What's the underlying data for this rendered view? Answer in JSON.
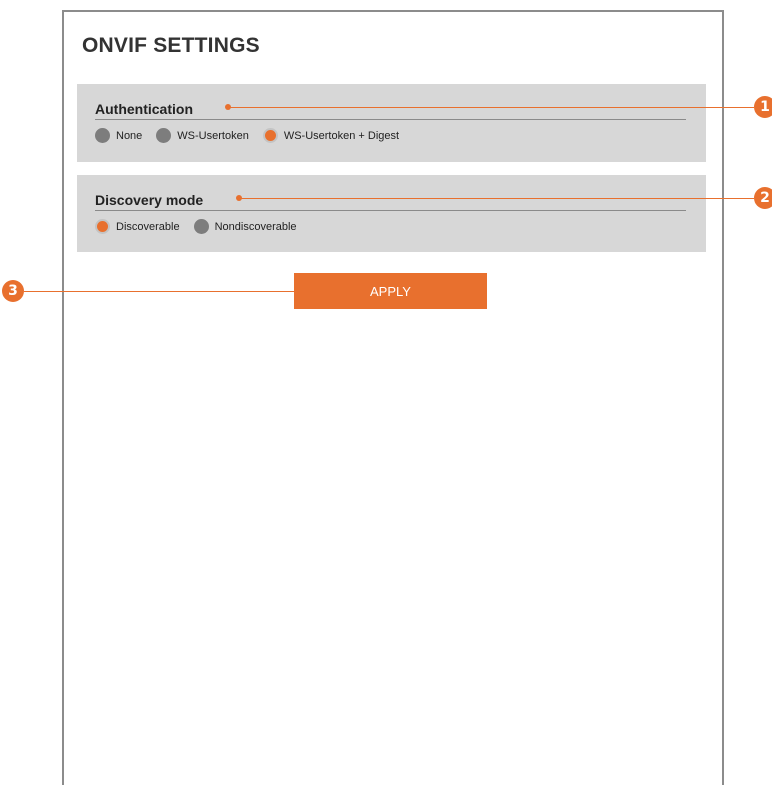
{
  "page": {
    "title": "ONVIF SETTINGS"
  },
  "authentication": {
    "label": "Authentication",
    "options": [
      "None",
      "WS-Usertoken",
      "WS-Usertoken + Digest"
    ],
    "selected": "WS-Usertoken + Digest"
  },
  "discovery": {
    "label": "Discovery mode",
    "options": [
      "Discoverable",
      "Nondiscoverable"
    ],
    "selected": "Discoverable"
  },
  "apply_label": "APPLY",
  "callouts": [
    "1",
    "2",
    "3"
  ],
  "colors": {
    "accent": "#e8702e",
    "panel": "#d7d7d7",
    "radio_off": "#7d7d7d"
  }
}
